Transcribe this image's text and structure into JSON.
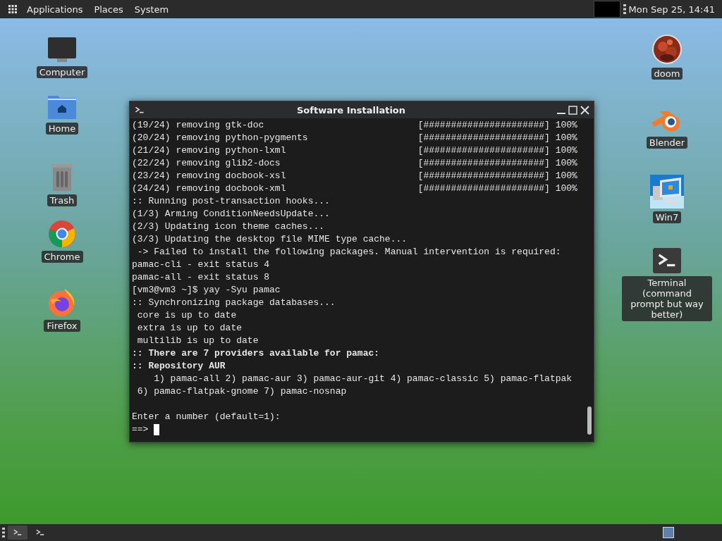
{
  "top_panel": {
    "menus": [
      "Applications",
      "Places",
      "System"
    ],
    "clock": "Mon Sep 25, 14:41"
  },
  "desktop_icons_left": [
    {
      "kind": "computer",
      "label": "Computer"
    },
    {
      "kind": "folder",
      "label": "Home"
    },
    {
      "kind": "trash",
      "label": "Trash"
    },
    {
      "kind": "chrome",
      "label": "Chrome"
    },
    {
      "kind": "firefox",
      "label": "Firefox"
    }
  ],
  "desktop_icons_right": [
    {
      "kind": "picture",
      "label": "doom"
    },
    {
      "kind": "blender",
      "label": "Blender"
    },
    {
      "kind": "win7",
      "label": "Win7"
    },
    {
      "kind": "terminal",
      "label": "Terminal (command prompt but way better)"
    }
  ],
  "window": {
    "title": "Software Installation",
    "lines": [
      {
        "kind": "progress",
        "text": "(19/24) removing gtk-doc",
        "progress": "[######################] 100%"
      },
      {
        "kind": "progress",
        "text": "(20/24) removing python-pygments",
        "progress": "[######################] 100%"
      },
      {
        "kind": "progress",
        "text": "(21/24) removing python-lxml",
        "progress": "[######################] 100%"
      },
      {
        "kind": "progress",
        "text": "(22/24) removing glib2-docs",
        "progress": "[######################] 100%"
      },
      {
        "kind": "progress",
        "text": "(23/24) removing docbook-xsl",
        "progress": "[######################] 100%"
      },
      {
        "kind": "progress",
        "text": "(24/24) removing docbook-xml",
        "progress": "[######################] 100%"
      },
      {
        "kind": "plain",
        "text": ":: Running post-transaction hooks..."
      },
      {
        "kind": "plain",
        "text": "(1/3) Arming ConditionNeedsUpdate..."
      },
      {
        "kind": "plain",
        "text": "(2/3) Updating icon theme caches..."
      },
      {
        "kind": "plain",
        "text": "(3/3) Updating the desktop file MIME type cache..."
      },
      {
        "kind": "plain",
        "text": " -> Failed to install the following packages. Manual intervention is required:"
      },
      {
        "kind": "plain",
        "text": "pamac-cli - exit status 4"
      },
      {
        "kind": "plain",
        "text": "pamac-all - exit status 8"
      },
      {
        "kind": "plain",
        "text": "[vm3@vm3 ~]$ yay -Syu pamac"
      },
      {
        "kind": "plain",
        "text": ":: Synchronizing package databases..."
      },
      {
        "kind": "plain",
        "text": " core is up to date"
      },
      {
        "kind": "plain",
        "text": " extra is up to date"
      },
      {
        "kind": "plain",
        "text": " multilib is up to date"
      },
      {
        "kind": "bold",
        "text": ":: There are 7 providers available for pamac:"
      },
      {
        "kind": "bold",
        "text": ":: Repository AUR"
      },
      {
        "kind": "plain",
        "text": "    1) pamac-all 2) pamac-aur 3) pamac-aur-git 4) pamac-classic 5) pamac-flatpak"
      },
      {
        "kind": "plain",
        "text": " 6) pamac-flatpak-gnome 7) pamac-nosnap"
      },
      {
        "kind": "blank"
      },
      {
        "kind": "plain",
        "text": "Enter a number (default=1):"
      },
      {
        "kind": "prompt",
        "text": "==>"
      }
    ]
  },
  "taskbar": {
    "tasks": [
      {
        "selected": true
      },
      {
        "selected": false
      }
    ]
  }
}
